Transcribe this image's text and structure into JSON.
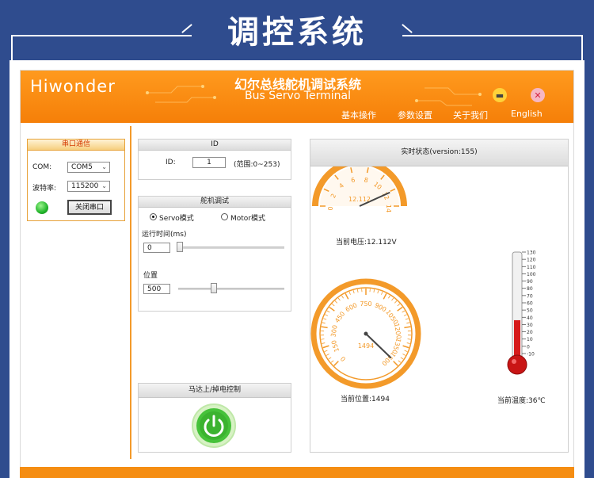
{
  "banner": {
    "title": "调控系统"
  },
  "app": {
    "logo": "Hiwonder",
    "title_cn": "幻尔总线舵机调试系统",
    "title_en": "Bus Servo Terminal",
    "minimize_icon": "minimize-icon",
    "close_icon": "close-icon",
    "colors": {
      "accent": "#f58d12",
      "banner": "#2f4c8e",
      "gauge": "#f39a2a"
    }
  },
  "menu": [
    "基本操作",
    "参数设置",
    "关于我们",
    "English"
  ],
  "serial": {
    "title": "串口通信",
    "com_label": "COM:",
    "com_value": "COM5",
    "baud_label": "波特率:",
    "baud_value": "115200",
    "button": "关闭串口",
    "led_state": "on"
  },
  "id_panel": {
    "title": "ID",
    "label": "ID:",
    "value": "1",
    "range": "(范围:0~253)"
  },
  "servo": {
    "title": "舵机调试",
    "mode_servo": "Servo模式",
    "mode_motor": "Motor模式",
    "selected_mode": "servo",
    "time_label": "运行时间(ms)",
    "time_value": "0",
    "position_label": "位置",
    "position_value": "500"
  },
  "motor": {
    "title": "马达上/掉电控制",
    "icon": "power-icon"
  },
  "status": {
    "title": "实时状态(version:155)",
    "voltage": {
      "ticks": [
        "0",
        "2",
        "4",
        "6",
        "8",
        "10",
        "12",
        "14"
      ],
      "value": 12.112,
      "readout": "12.112",
      "label": "当前电压:12.112V"
    },
    "position": {
      "ticks": [
        "0",
        "150",
        "300",
        "450",
        "600",
        "750",
        "900",
        "1050",
        "1200",
        "1350",
        "1500"
      ],
      "value": 1494,
      "readout": "1494",
      "label": "当前位置:1494"
    },
    "temperature": {
      "ticks": [
        "130",
        "120",
        "110",
        "100",
        "90",
        "80",
        "70",
        "60",
        "50",
        "40",
        "30",
        "20",
        "10",
        "0",
        "-10"
      ],
      "value": 36,
      "label": "当前温度:36℃"
    }
  }
}
